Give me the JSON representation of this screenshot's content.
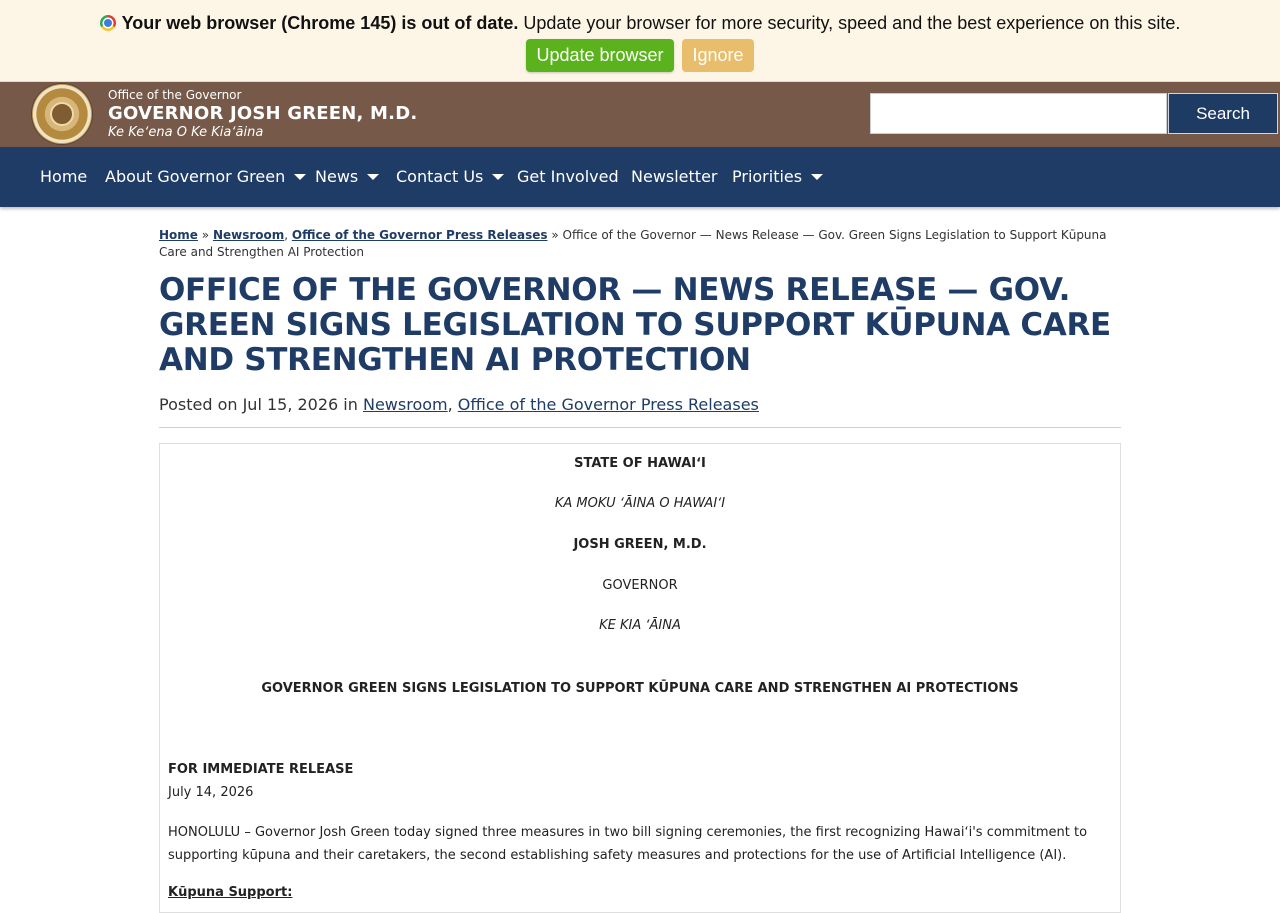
{
  "update_banner": {
    "bold_text": "Your web browser (Chrome 145) is out of date.",
    "message": "Update your browser for more security, speed and the best experience on this site.",
    "update_button": "Update browser",
    "ignore_button": "Ignore",
    "icon": "chrome-icon"
  },
  "header": {
    "office": "Office of the Governor",
    "name": "GOVERNOR JOSH GREEN, M.D.",
    "hawaiian": "Ke Keʻena O Ke Kiaʻāina",
    "seal_icon": "state-seal-icon",
    "search": {
      "placeholder": "",
      "value": "",
      "button": "Search"
    },
    "colors": {
      "header_bg": "#77594a",
      "nav_bg": "#1f3c66"
    }
  },
  "nav": [
    {
      "label": "Home",
      "dropdown": false
    },
    {
      "label": "About Governor Green",
      "dropdown": true
    },
    {
      "label": "News",
      "dropdown": true
    },
    {
      "label": "Contact Us",
      "dropdown": true
    },
    {
      "label": "Get Involved",
      "dropdown": false
    },
    {
      "label": "Newsletter",
      "dropdown": false
    },
    {
      "label": "Priorities",
      "dropdown": true
    }
  ],
  "breadcrumb": {
    "home": "Home",
    "sep1": "»",
    "cat1": "Newsroom",
    "comma": ",",
    "cat2": "Office of the Governor Press Releases",
    "sep2": "»",
    "current": "Office of the Governor — News Release — Gov. Green Signs Legislation to Support Kūpuna Care and Strengthen AI Protection"
  },
  "article": {
    "title": "Office of the Governor — News Release — Gov. Green Signs Legislation to Support Kūpuna Care and Strengthen AI Protection",
    "posted_prefix": "Posted on Jul 15, 2026 in",
    "category1": "Newsroom",
    "comma": ",",
    "category2": "Office of the Governor Press Releases"
  },
  "release": {
    "state": "STATE OF HAWAIʻI",
    "state_hawaiian": "KA MOKU ʻĀINA O HAWAIʻI",
    "governor_name": "JOSH GREEN, M.D.",
    "governor_title": "GOVERNOR",
    "governor_hawaiian": "KE KIA ʻĀINA",
    "headline": "GOVERNOR GREEN SIGNS LEGISLATION TO SUPPORT KŪPUNA CARE AND STRENGTHEN AI PROTECTIONS",
    "for_release": "FOR IMMEDIATE RELEASE",
    "date": "July 14, 2026",
    "lead_1": "HONOLULU – Governor Josh Green today signed three measures in two bill signing ceremonies, the first recognizing Hawaiʻi's commitment to",
    "lead_2": "supporting kūpuna and their caretakers, the second establishing safety measures and protections for the use of Artificial Intelligence (AI).",
    "section1": "Kūpuna Support:"
  }
}
